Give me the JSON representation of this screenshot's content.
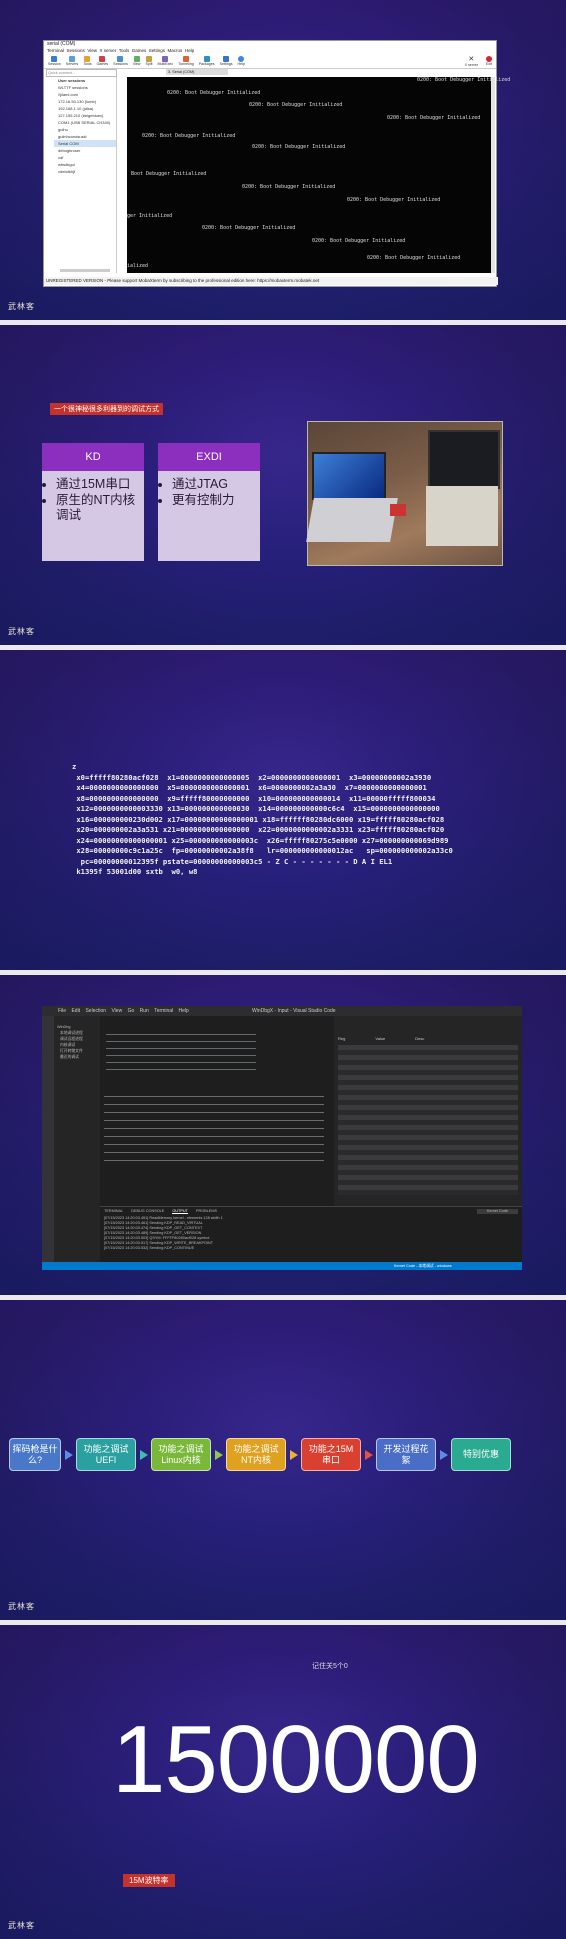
{
  "slide1": {
    "window_title": "serial (COM)",
    "menu": [
      "Terminal",
      "Sessions",
      "View",
      "X server",
      "Tools",
      "Games",
      "Settings",
      "Macros",
      "Help"
    ],
    "toolbar": [
      "Session",
      "Servers",
      "Tools",
      "Games",
      "Sessions",
      "View",
      "Split",
      "MultiExec",
      "Tunneling",
      "Packages",
      "Settings",
      "Help"
    ],
    "toolbar_right": [
      "X server",
      "Exit"
    ],
    "quick_connect": "Quick connect...",
    "tab_label": "3. Serial (COM)",
    "sessions_header": "User sessions",
    "sessions": [
      "WLTTF sessions",
      "\\\\jilami.com",
      "172.16.50.130 (lumb)",
      "192.168.1.10 (jdlsa)",
      "127.155.210 (beigebluex)",
      "COM1 (USB SERIAL CH340)",
      "guihu",
      "guiinhcondsuski",
      "Serial COM",
      "debugbroser",
      "vdf",
      "wbsdkgui",
      "vdebdkhjf"
    ],
    "terminal_text": "0200: Boot Debugger Initialized",
    "terminal_lines": [
      "0200: Boot Debugger Initialized",
      "0200: Boot Debugger Initialized",
      "0200: Boot Debugger Initialized",
      "0200: Boot Debugger Initialized",
      "0200: Boot Debugger Initialized",
      "0200: Boot Debugger Initialized",
      "Boot Debugger Initialized",
      "0200: Boot Debugger Initialized",
      "0200: Boot Debugger Initialized",
      "ger Initialized",
      "0200: Boot Debugger Initialized",
      "0200: Boot Debugger Initialized",
      "0200: Boot Debugger Initialized",
      "ialized"
    ],
    "status": "UNREGISTERED VERSION  -  Please support MobaXterm by subscribing to the professional edition here:  https://mobaxterm.mobatek.net",
    "logo": "武林客"
  },
  "slide2": {
    "tag": "一个很神秘很多利器到的调试方式",
    "cards": [
      {
        "title": "KD",
        "items": [
          "通过15M串口",
          "原生的NT内核调试"
        ]
      },
      {
        "title": "EXDI",
        "items": [
          "通过JTAG",
          "更有控制力"
        ]
      }
    ],
    "logo": "武林客"
  },
  "slide3": {
    "regs": "z\n x0=fffff80280acf028  x1=0000000000000005  x2=0000000000000001  x3=00000000002a3930\n x4=0000000000000000  x5=0000000000000001  x6=0000000002a3a30  x7=0000000000000001\n x8=0000000000000000  x9=fffff80000000000  x10=000000000000014  x11=00000fffff800034\n x12=0000000000003330 x13=000000000000030  x14=000000000000c6c4  x15=0000000000000000\n x16=000000000230d002 x17=00000000000000001 x18=ffffff80280dc6000 x19=fffff80280acf028\n x20=000000002a3a531 x21=0000000000000000  x22=0000000000002a3331 x23=fffff80280acf020\n x24=00000000000000001 x25=000000000000003c  x26=fffff80275c5e0000 x27=000000000069d989\n x28=00000000c9c1a25c  fp=00000000002a38f8   lr=000000000000012ac   sp=000000000002a33c0\n  pc=00000000012395f pstate=00000000000003c5 - Z C - - - - - - - D A I EL1\n k1395f 53001d00 sxtb  w0, w8",
    "logo": ""
  },
  "slide4": {
    "title": "WinDbgX - Input - Visual Studio Code",
    "menu": [
      "File",
      "Edit",
      "Selection",
      "View",
      "Go",
      "Run",
      "Terminal",
      "Help"
    ],
    "panel_tabs": [
      "TERMINAL",
      "DEBUG CONSOLE",
      "OUTPUT",
      "PROBLEMS"
    ],
    "dropdown": "Kernel Code",
    "statusbar": "Kernel Code - 本地调试 - windows",
    "sidebar_items": [
      "WinDbg",
      "本地调试进程",
      "调试远程进程",
      "内核调试",
      "打开转储文件",
      "最近的调试"
    ],
    "output_lines": [
      "[07/15/2023 14:20:03.451] ReadMemory kernel - elements 128 width 1",
      "[07/15/2023 14:20:03.461] Sending KDP_READ_VIRTUAL",
      "[07/15/2023 14:20:03.474] Sending KDP_GET_CONTEXT",
      "[07/15/2023 14:20:03.489] Sending KDP_GET_VERSION",
      "[07/15/2023 14:20:03.503] QSYM: FFFFF80280acf028 symbol",
      "[07/15/2023 14:20:03.517] Sending KDP_WRITE_BREAKPOINT",
      "[07/15/2023 14:20:03.532] Sending KDP_CONTINUE",
      "[07/15/2023 14:20:03.547] Sending KDP_READ_STATE"
    ],
    "reg_header": [
      "Reg",
      "Value",
      "Desc"
    ]
  },
  "slide5": {
    "flow": [
      {
        "lines": [
          "挥码枪是什",
          "么?"
        ],
        "color": "#4a78c8",
        "arrow": "#5b8de8"
      },
      {
        "lines": [
          "功能之调试",
          "UEFI"
        ],
        "color": "#2aa0a0",
        "arrow": "#3dbdb0"
      },
      {
        "lines": [
          "功能之调试",
          "Linux内核"
        ],
        "color": "#7ab83a",
        "arrow": "#8dc84a"
      },
      {
        "lines": [
          "功能之调试",
          "NT内核"
        ],
        "color": "#e0a020",
        "arrow": "#f0b030"
      },
      {
        "lines": [
          "功能之15M",
          "串口"
        ],
        "color": "#d94030",
        "arrow": "#e85040"
      },
      {
        "lines": [
          "开发过程花",
          "絮"
        ],
        "color": "#4a6ec8",
        "arrow": "#5b8de8"
      },
      {
        "lines": [
          "特别优惠"
        ],
        "color": "#2aaa90",
        "arrow": ""
      }
    ],
    "logo": "武林客"
  },
  "slide6": {
    "caption": "记住关5个0",
    "number": "1500000",
    "tag": "15M波特率",
    "logo": "武林客"
  }
}
